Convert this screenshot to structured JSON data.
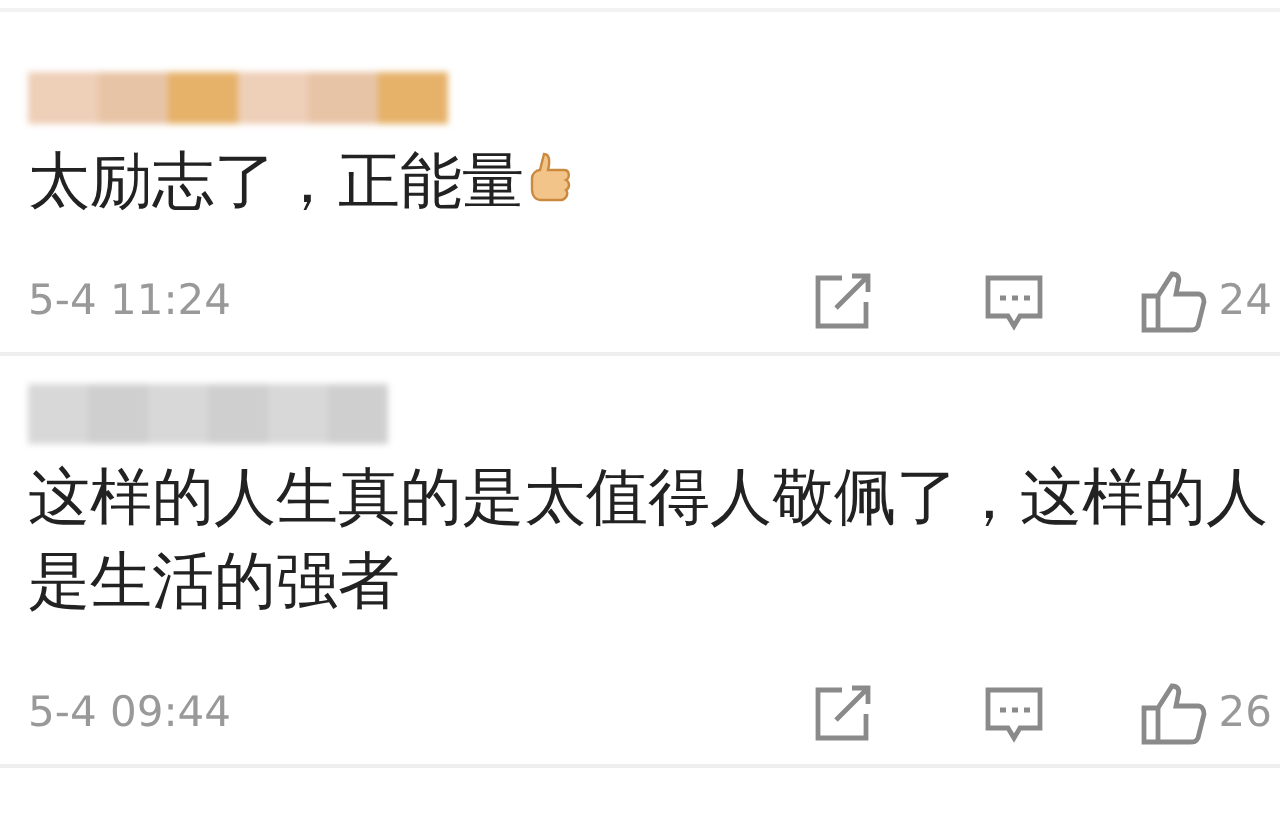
{
  "comments": [
    {
      "text": "太励志了，正能量",
      "emoji": true,
      "time": "5-4 11:24",
      "likes": "24"
    },
    {
      "text": "这样的人生真的是太值得人敬佩了，这样的人是生活的强者",
      "emoji": false,
      "time": "5-4 09:44",
      "likes": "26"
    }
  ]
}
